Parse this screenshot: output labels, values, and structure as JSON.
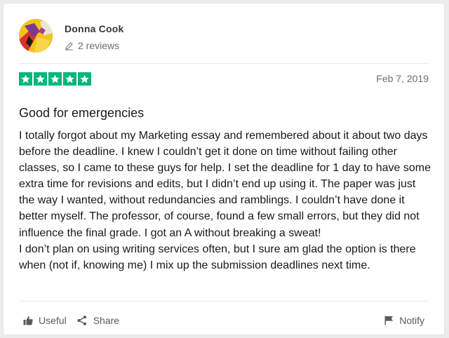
{
  "reviewer": {
    "name": "Donna Cook",
    "reviews_count": "2 reviews"
  },
  "review": {
    "rating": 5,
    "rating_max": 5,
    "date": "Feb 7, 2019",
    "title": "Good for emergencies",
    "paragraphs": [
      "I totally forgot about my Marketing essay and remembered about it about two days before the deadline. I knew I couldn’t get it done on time without failing other classes, so I came to these guys for help. I set the deadline for 1 day to have some extra time for revisions and edits, but I didn’t end up using it. The paper was just the way I wanted, without redundancies and ramblings. I couldn’t have done it better myself. The professor, of course, found a few small errors, but they did not influence the final grade. I got an A without breaking a sweat!",
      "I don’t plan on using writing services often, but I sure am glad the option is there when (not if, knowing me) I mix up the submission deadlines next time."
    ]
  },
  "actions": {
    "useful": "Useful",
    "share": "Share",
    "notify": "Notify"
  },
  "colors": {
    "star_green": "#00b67a",
    "text_primary": "#191919",
    "text_secondary": "#6d6d6d"
  },
  "icons": {
    "avatar": "avatar-image",
    "reviews": "pencil-icon",
    "star": "star-icon",
    "useful": "thumbs-up-icon",
    "share": "share-icon",
    "notify": "flag-icon"
  }
}
